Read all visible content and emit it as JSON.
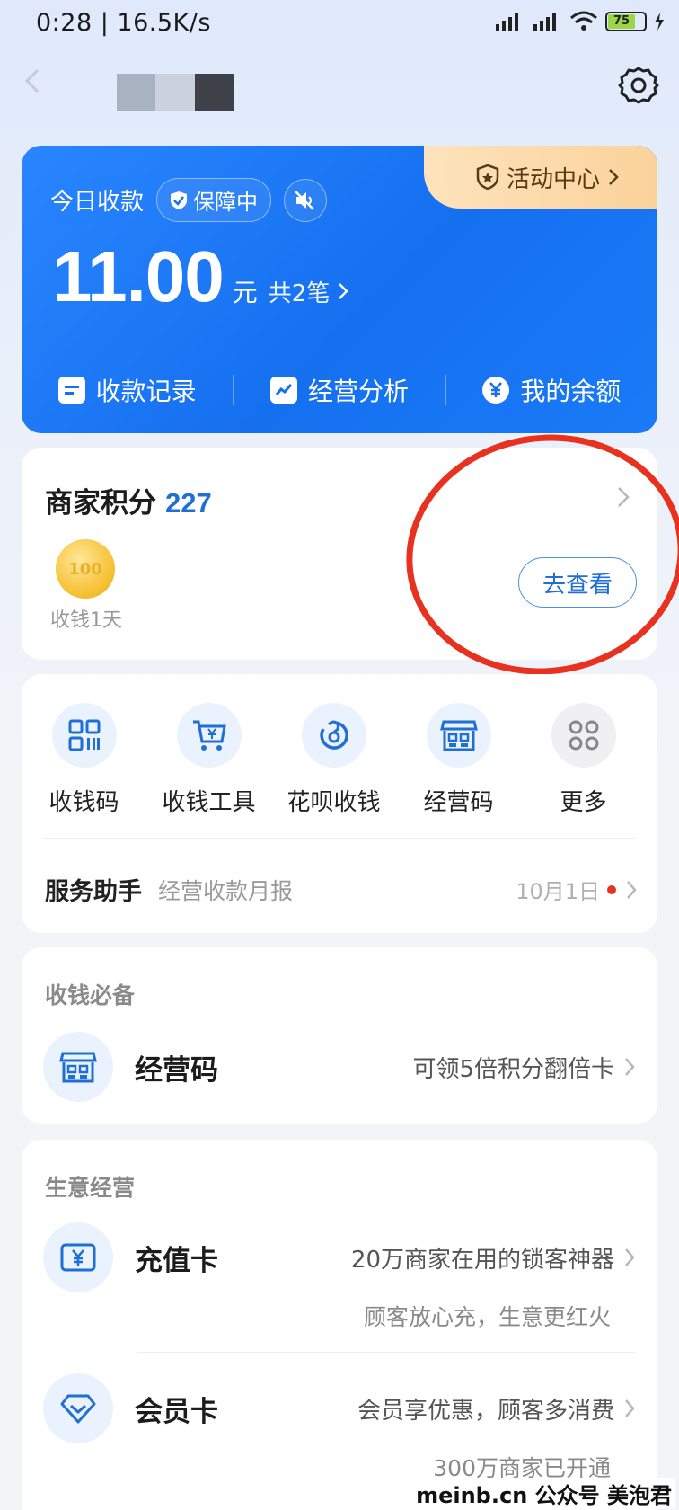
{
  "status_bar": {
    "time": "0:28 | 16.5K/s",
    "battery": "75"
  },
  "header": {
    "title_blurred": true
  },
  "summary_card": {
    "activity_center": "活动中心",
    "today_label": "今日收款",
    "protection_badge": "保障中",
    "amount": "11.00",
    "amount_unit": "元",
    "count_text": "共2笔",
    "actions": [
      {
        "label": "收款记录",
        "icon": "receipt-icon"
      },
      {
        "label": "经营分析",
        "icon": "analysis-chart-icon"
      },
      {
        "label": "我的余额",
        "icon": "yuan-coin-icon"
      }
    ]
  },
  "points": {
    "title": "商家积分",
    "value": "227",
    "coin_value": "100",
    "coin_label": "收钱1天",
    "view_button": "去查看"
  },
  "tools": {
    "items": [
      {
        "label": "收钱码",
        "icon": "qr-code-icon"
      },
      {
        "label": "收钱工具",
        "icon": "cart-yuan-icon"
      },
      {
        "label": "花呗收钱",
        "icon": "huabei-icon"
      },
      {
        "label": "经营码",
        "icon": "store-qr-icon"
      },
      {
        "label": "更多",
        "icon": "more-grid-icon"
      }
    ],
    "assistant_title": "服务助手",
    "assistant_subtitle": "经营收款月报",
    "assistant_date": "10月1日"
  },
  "essentials": {
    "section_title": "收钱必备",
    "item_title": "经营码",
    "item_desc": "可领5倍积分翻倍卡"
  },
  "business": {
    "section_title": "生意经营",
    "items": [
      {
        "title": "充值卡",
        "desc": "20万商家在用的锁客神器",
        "sub": "顾客放心充，生意更红火"
      },
      {
        "title": "会员卡",
        "desc": "会员享优惠，顾客多消费",
        "sub": "300万商家已开通"
      }
    ]
  },
  "watermark": "meinb.cn  公众号 美泡君",
  "colors": {
    "brand_blue": "#1570f0",
    "accent_blue": "#1f6fd6",
    "annotation_red": "#e8321f",
    "activity_orange": "#fbd29a"
  }
}
